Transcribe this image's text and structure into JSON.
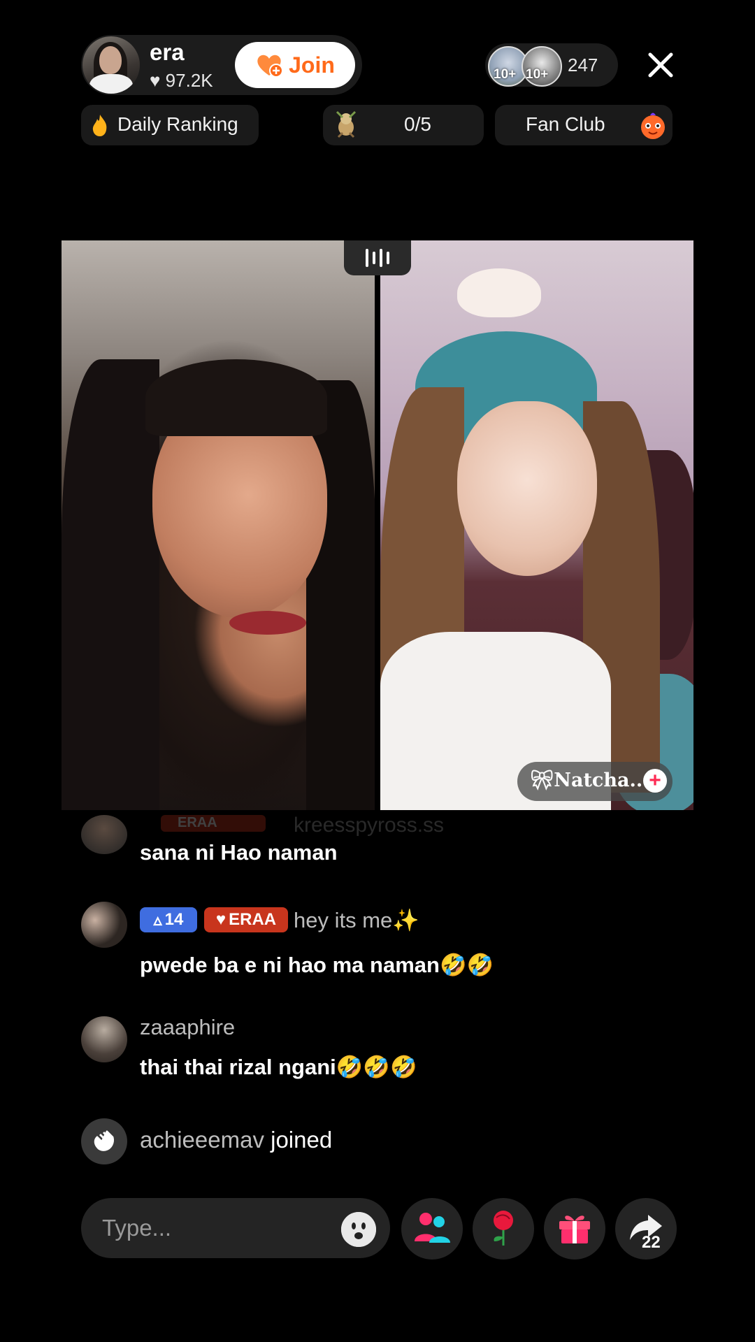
{
  "host": {
    "name": "era",
    "likes": "97.2K",
    "join_label": "Join"
  },
  "viewers": {
    "avatar_badges": [
      "10+",
      "10+"
    ],
    "count": "247"
  },
  "ribbon": {
    "daily_ranking": "Daily Ranking",
    "goal_progress": "0/5",
    "fan_club": "Fan Club"
  },
  "guest": {
    "name": "Natcha..."
  },
  "comments": {
    "faded_user": "kreesspyross.ss",
    "faded_badge": "ERAA",
    "items": [
      {
        "user": "",
        "text": "sana ni Hao naman"
      },
      {
        "level": "14",
        "fan_badge": "ERAA",
        "user": "hey its me✨",
        "text": "pwede ba e ni hao ma naman🤣🤣"
      },
      {
        "user": "zaaaphire",
        "text": "thai thai rizal ngani🤣🤣🤣"
      }
    ],
    "joined_user": "achieeemav",
    "joined_label": "joined"
  },
  "input": {
    "placeholder": "Type..."
  },
  "actions": {
    "share_count": "22"
  },
  "colors": {
    "join_accent": "#ff6a1a",
    "level_badge": "#3f6de0",
    "fan_badge": "#c8351d"
  }
}
